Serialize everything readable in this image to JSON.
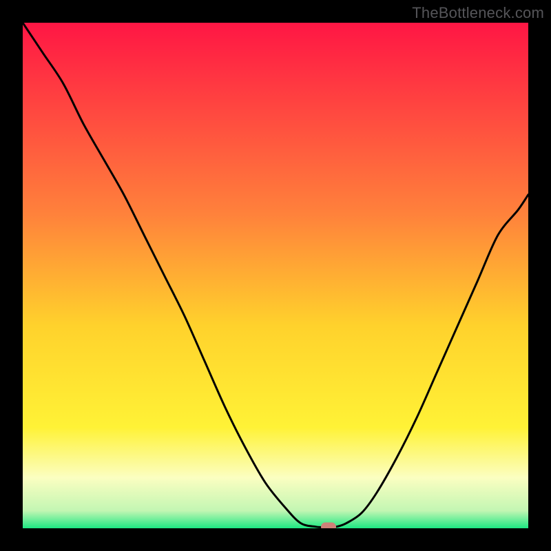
{
  "watermark": "TheBottleneck.com",
  "colors": {
    "gradient_top": "#ff1644",
    "gradient_upper_mid": "#ff823b",
    "gradient_mid": "#ffd22c",
    "gradient_low": "#fff236",
    "gradient_pale": "#fbfec1",
    "gradient_bottom": "#1de782",
    "curve": "#000000",
    "marker": "#cf8179",
    "frame": "#000000"
  },
  "chart_data": {
    "type": "line",
    "title": "",
    "xlabel": "",
    "ylabel": "",
    "xlim": [
      0,
      100
    ],
    "ylim": [
      0,
      100
    ],
    "grid": false,
    "series": [
      {
        "name": "bottleneck-curve",
        "x": [
          0,
          4,
          8,
          12,
          16,
          20,
          24,
          28,
          32,
          36,
          40,
          44,
          48,
          52,
          55,
          58,
          60,
          62,
          64,
          67,
          70,
          74,
          78,
          82,
          86,
          90,
          94,
          98,
          100
        ],
        "y": [
          100,
          94,
          88,
          80,
          73,
          66,
          58,
          50,
          42,
          33,
          24,
          16,
          9,
          4,
          1,
          0.3,
          0.2,
          0.3,
          1,
          3,
          7,
          14,
          22,
          31,
          40,
          49,
          58,
          63,
          66
        ]
      }
    ],
    "marker": {
      "x": 60.5,
      "y": 0.3
    },
    "gradient_stops": [
      {
        "pos": 0.0,
        "color": "#ff1644"
      },
      {
        "pos": 0.38,
        "color": "#ff823b"
      },
      {
        "pos": 0.6,
        "color": "#ffd22c"
      },
      {
        "pos": 0.8,
        "color": "#fff236"
      },
      {
        "pos": 0.9,
        "color": "#fbfec1"
      },
      {
        "pos": 0.965,
        "color": "#c3f6b3"
      },
      {
        "pos": 1.0,
        "color": "#1de782"
      }
    ]
  }
}
